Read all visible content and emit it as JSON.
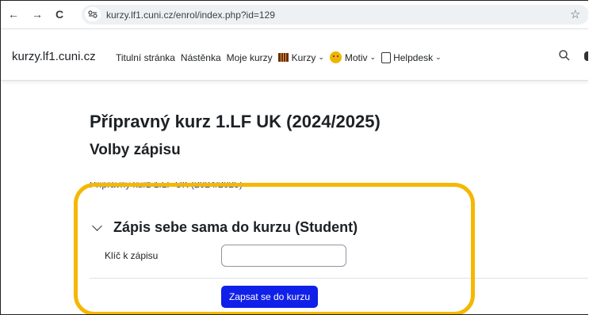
{
  "browser": {
    "back_icon": "←",
    "forward_icon": "→",
    "reload_icon": "C",
    "site_icon": "site-settings-icon",
    "url": "kurzy.lf1.cuni.cz/enrol/index.php?id=129",
    "bookmark_icon": "☆"
  },
  "navbar": {
    "brand": "kurzy.lf1.cuni.cz",
    "items": {
      "home": "Titulní stránka",
      "dashboard": "Nástěnka",
      "my_courses": "Moje kurzy",
      "courses": "Kurzy",
      "theme": "Motiv",
      "helpdesk": "Helpdesk"
    }
  },
  "page": {
    "title": "Přípravný kurz 1.LF UK (2024/2025)",
    "subtitle": "Volby zápisu",
    "breadcrumb": "Přípravný kurz 1.LF UK (2024/2025)"
  },
  "enrol": {
    "section_title": "Zápis sebe sama do kurzu (Student)",
    "key_label": "Klíč k zápisu",
    "key_value": "",
    "button_label": "Zapsat se do kurzu"
  },
  "colors": {
    "highlight": "#f5b700",
    "button": "#1020e8",
    "link": "#0f47ad"
  }
}
